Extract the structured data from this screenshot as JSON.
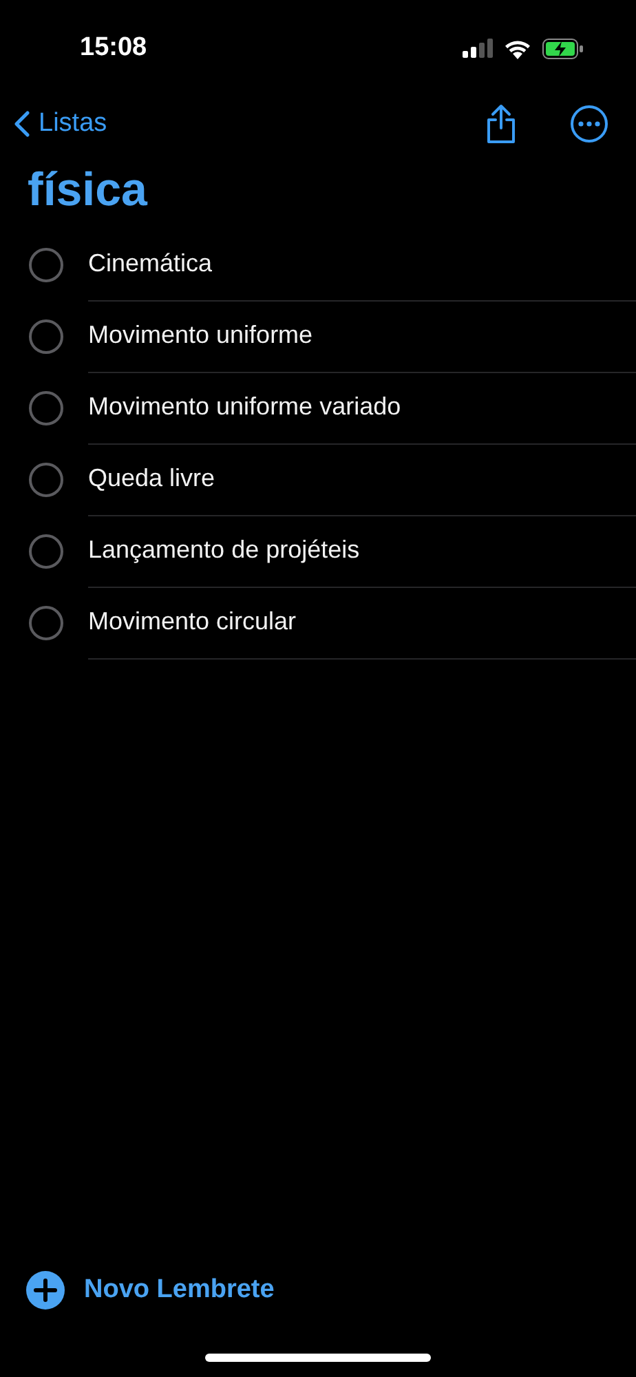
{
  "status_bar": {
    "time": "15:08"
  },
  "nav": {
    "back_label": "Listas"
  },
  "title": "física",
  "reminders": [
    {
      "text": "Cinemática",
      "checked": false
    },
    {
      "text": "Movimento uniforme",
      "checked": false
    },
    {
      "text": "Movimento uniforme variado",
      "checked": false
    },
    {
      "text": "Queda livre",
      "checked": false
    },
    {
      "text": "Lançamento de projéteis",
      "checked": false
    },
    {
      "text": "Movimento circular",
      "checked": false
    }
  ],
  "new_reminder": {
    "label": "Novo Lembrete"
  }
}
